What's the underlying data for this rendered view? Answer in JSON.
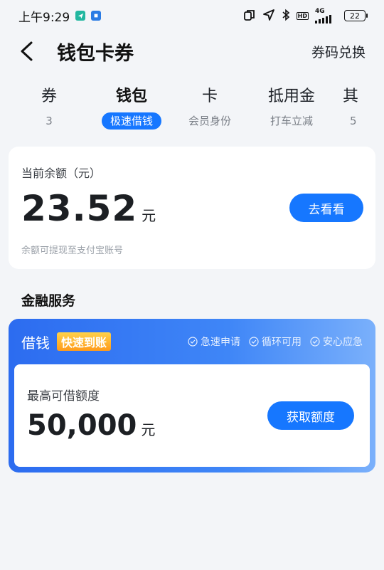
{
  "status_bar": {
    "time": "上午9:29",
    "network": "4G",
    "hd": "HD",
    "battery": "22"
  },
  "header": {
    "title": "钱包卡券",
    "action": "券码兑换"
  },
  "tabs": [
    {
      "title": "券",
      "sub": "3"
    },
    {
      "title": "钱包",
      "sub": "极速借钱"
    },
    {
      "title": "卡",
      "sub": "会员身份"
    },
    {
      "title": "抵用金",
      "sub": "打车立减"
    },
    {
      "title": "其",
      "sub": "5"
    }
  ],
  "balance": {
    "label": "当前余额（元）",
    "amount": "23.52",
    "unit": "元",
    "button": "去看看",
    "note": "余额可提现至支付宝账号"
  },
  "section_title": "金融服务",
  "finance": {
    "name": "借钱",
    "tag": "快速到账",
    "features": [
      "急速申请",
      "循环可用",
      "安心应急"
    ],
    "limit_label": "最高可借额度",
    "limit_amount": "50,000",
    "limit_unit": "元",
    "button": "获取额度"
  }
}
